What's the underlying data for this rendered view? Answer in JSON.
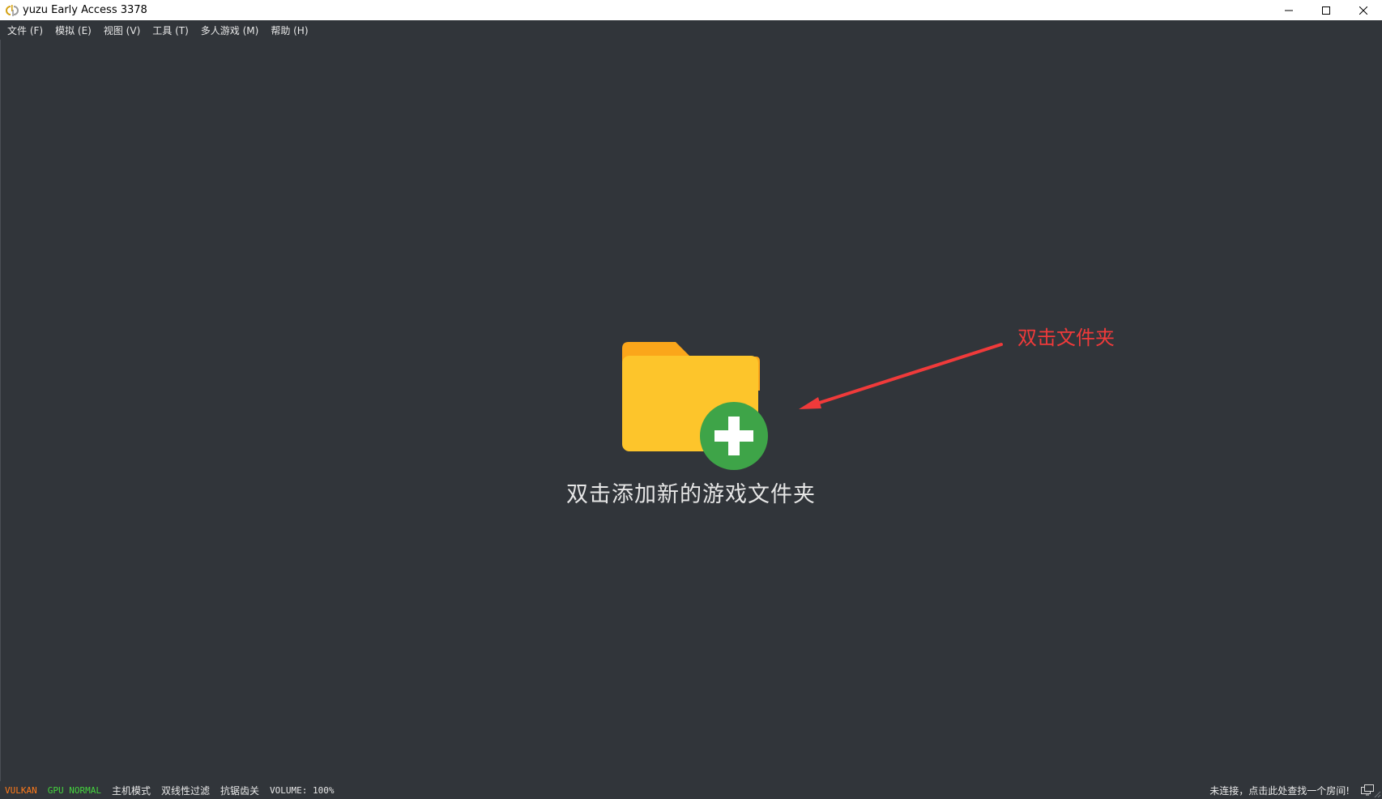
{
  "window": {
    "title": "yuzu Early Access 3378",
    "app_icon": "yuzu-logo-icon",
    "controls": [
      "minimize-icon",
      "maximize-icon",
      "close-icon"
    ]
  },
  "menubar": {
    "items": [
      {
        "label": "文件 (F)"
      },
      {
        "label": "模拟 (E)"
      },
      {
        "label": "视图 (V)"
      },
      {
        "label": "工具 (T)"
      },
      {
        "label": "多人游戏 (M)"
      },
      {
        "label": "帮助 (H)"
      }
    ]
  },
  "main": {
    "folder_icon": "add-folder-icon",
    "placeholder_text": "双击添加新的游戏文件夹"
  },
  "annotation": {
    "text": "双击文件夹",
    "color": "#f03a3a"
  },
  "statusbar": {
    "renderer": "VULKAN",
    "gpu": "GPU NORMAL",
    "dock_mode": "主机模式",
    "filter": "双线性过滤",
    "aa": "抗锯齿关",
    "volume": "VOLUME: 100%",
    "room_status": "未连接，点击此处查找一个房间!",
    "room_icon": "multiplayer-room-icon"
  },
  "colors": {
    "background": "#31353a",
    "vulkan": "#ff7a1a",
    "gpu_normal": "#45d33e",
    "folder": "#fdc52b",
    "folder_tab": "#fba61a",
    "plus_circle": "#3ea448"
  }
}
